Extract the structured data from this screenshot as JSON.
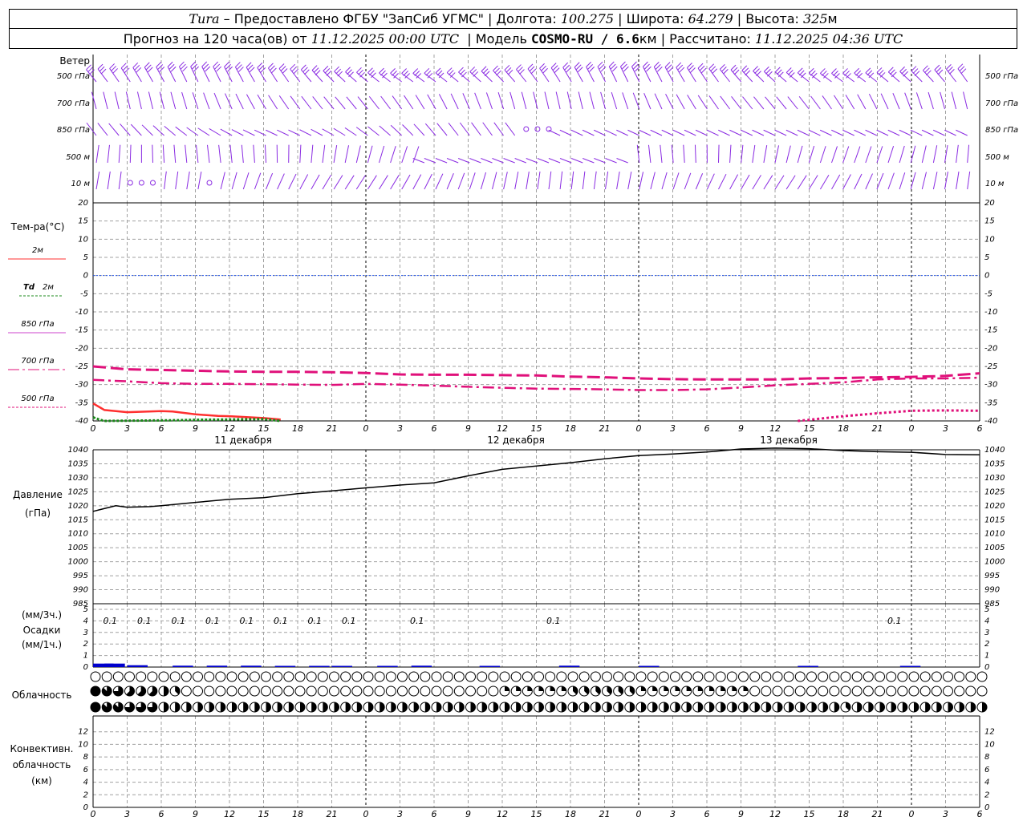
{
  "header": {
    "station": "Tura",
    "provider": "– Предоставлено ФГБУ \"ЗапСиб УГМС\"",
    "lon_label": "Долгота:",
    "lon": "100.275",
    "lat_label": "Широта:",
    "lat": "64.279",
    "alt_label": "Высота:",
    "alt": "325",
    "alt_unit": "м",
    "fc_label": "Прогноз на 120 часа(ов) от",
    "fc_start": "11.12.2025 00:00 UTC",
    "model_label": "Модель",
    "model": "COSMO-RU / 6.6",
    "model_unit": "км",
    "calc_label": "Рассчитано:",
    "calc_time": "11.12.2025 04:36 UTC"
  },
  "labels": {
    "wind": "Ветер",
    "wind_levels": [
      "500 гПа",
      "700 гПа",
      "850 гПа",
      "500 м",
      "10 м"
    ],
    "temp_title": "Тем-ра(°С)",
    "leg_2m": "2м",
    "leg_td": "Td",
    "leg_td2": "2м",
    "leg_850": "850 гПа",
    "leg_700": "700 гПа",
    "leg_500": "500 гПа",
    "pressure": "Давление",
    "pressure_unit": "(гПа)",
    "precip_unit3": "(мм/3ч.)",
    "precip": "Осадки",
    "precip_unit1": "(мм/1ч.)",
    "cloud": "Облачность",
    "conv1": "Конвективн.",
    "conv2": "облачность",
    "conv3": "(км)",
    "day1": "11 декабря",
    "day2": "12 декабря",
    "day3": "13 декабря"
  },
  "colors": {
    "t2m": "#ff3030",
    "td2m": "#1a8a1a",
    "t850": "#cc44cc",
    "t700": "#e0107a",
    "t500": "#e0107a",
    "pressure": "#000000",
    "precip": "#0000cc",
    "wind": "#8a2be2",
    "zero_line": "#2255ee"
  },
  "chart_data": [
    {
      "type": "line",
      "name": "temperature",
      "x_hours": [
        0,
        3,
        6,
        9,
        12,
        15,
        18,
        21,
        24,
        27,
        30,
        33,
        36,
        39,
        42,
        45,
        48,
        51,
        54,
        57,
        60,
        63,
        66,
        69,
        72,
        75,
        78
      ],
      "x_tick_labels": [
        "0",
        "3",
        "6",
        "9",
        "12",
        "15",
        "18",
        "21",
        "0",
        "3",
        "6",
        "9",
        "12",
        "15",
        "18",
        "21",
        "0",
        "3",
        "6",
        "9",
        "12",
        "15",
        "18",
        "21",
        "0",
        "3",
        "6"
      ],
      "ylim": [
        -40,
        20
      ],
      "y_ticks": [
        20,
        15,
        10,
        5,
        0,
        -5,
        -10,
        -15,
        -20,
        -25,
        -30,
        -35,
        -40
      ],
      "series": [
        {
          "name": "2м",
          "x": [
            0,
            1,
            3,
            6,
            7,
            9,
            11,
            12,
            15,
            16.5
          ],
          "y": [
            -35.2,
            -37,
            -37.6,
            -37.3,
            -37.4,
            -38.2,
            -38.6,
            -38.7,
            -39.2,
            -39.6
          ]
        },
        {
          "name": "Td 2м",
          "x": [
            0,
            0.6,
            1,
            7.5,
            9,
            12,
            15,
            16.5
          ],
          "y": [
            -39,
            -39.7,
            -40,
            -39.8,
            -39.7,
            -39.6,
            -39.5,
            -40
          ]
        },
        {
          "name": "700 гПа",
          "x": [
            0,
            3,
            6,
            9,
            12,
            15,
            18,
            21,
            24,
            27,
            30,
            33,
            36,
            39,
            42,
            45,
            48,
            51,
            54,
            57,
            60,
            63,
            66,
            69,
            72,
            75,
            78
          ],
          "y": [
            -25,
            -25.8,
            -26,
            -26.2,
            -26.4,
            -26.5,
            -26.5,
            -26.6,
            -26.8,
            -27.2,
            -27.3,
            -27.3,
            -27.4,
            -27.5,
            -27.8,
            -28,
            -28.3,
            -28.5,
            -28.6,
            -28.6,
            -28.6,
            -28.3,
            -28.2,
            -28,
            -27.9,
            -27.6,
            -26.9
          ]
        },
        {
          "name": "850 гПа",
          "x": [
            0,
            3,
            6,
            9,
            12,
            15,
            18,
            21,
            24,
            27,
            30,
            33,
            36,
            39,
            42,
            45,
            48,
            51,
            54,
            57,
            60,
            63,
            66,
            69,
            72,
            75,
            78
          ],
          "y": [
            -28.7,
            -29.1,
            -29.6,
            -29.8,
            -29.8,
            -29.9,
            -30,
            -30.1,
            -29.8,
            -30,
            -30.3,
            -30.6,
            -30.9,
            -31.1,
            -31.2,
            -31.3,
            -31.5,
            -31.5,
            -31.3,
            -30.8,
            -30.2,
            -29.8,
            -29.4,
            -28.6,
            -28.3,
            -28.3,
            -28.1
          ]
        },
        {
          "name": "500 гПа",
          "x": [
            62,
            63,
            66,
            69,
            72,
            75,
            78
          ],
          "y": [
            -40,
            -39.7,
            -38.7,
            -37.9,
            -37.2,
            -37.1,
            -37.2
          ]
        }
      ]
    },
    {
      "type": "line",
      "name": "pressure",
      "ylim": [
        985,
        1040
      ],
      "y_ticks": [
        1040,
        1035,
        1030,
        1025,
        1020,
        1015,
        1010,
        1005,
        1000,
        995,
        990,
        985
      ],
      "series": [
        {
          "name": "Давление",
          "x": [
            0,
            2,
            3,
            5,
            6,
            9,
            12,
            15,
            18,
            21,
            24,
            27,
            30,
            33,
            36,
            39,
            42,
            45,
            48,
            51,
            54,
            57,
            60,
            63,
            66,
            69,
            72,
            75,
            78
          ],
          "y": [
            1018,
            1020,
            1019.5,
            1019.7,
            1020,
            1021.2,
            1022.3,
            1022.9,
            1024.3,
            1025.3,
            1026.4,
            1027.4,
            1028.2,
            1030.7,
            1033,
            1034.2,
            1035.4,
            1036.8,
            1037.9,
            1038.5,
            1039.2,
            1040.3,
            1040.6,
            1040.4,
            1039.7,
            1039.3,
            1039.1,
            1038.3,
            1038.2
          ]
        }
      ]
    },
    {
      "type": "bar",
      "name": "precipitation",
      "ylim": [
        0,
        5
      ],
      "y_ticks": [
        5,
        4,
        3,
        2,
        1,
        0
      ],
      "labels_3h": [
        {
          "x": 1.5,
          "text": "0.1"
        },
        {
          "x": 4.5,
          "text": "0.1"
        },
        {
          "x": 7.5,
          "text": "0.1"
        },
        {
          "x": 10.5,
          "text": "0.1"
        },
        {
          "x": 13.5,
          "text": "0.1"
        },
        {
          "x": 16.5,
          "text": "0.1"
        },
        {
          "x": 19.5,
          "text": "0.1"
        },
        {
          "x": 22.5,
          "text": "0.1"
        },
        {
          "x": 28.5,
          "text": "0.1"
        },
        {
          "x": 40.5,
          "text": "0.1"
        },
        {
          "x": 70.5,
          "text": "0.1"
        }
      ],
      "bars_x": [
        0,
        1,
        3,
        7,
        10,
        13,
        16,
        19,
        21,
        25,
        28,
        34,
        41,
        48,
        62,
        71
      ],
      "values": [
        0.15,
        0.15,
        0.08,
        0.06,
        0.06,
        0.06,
        0.05,
        0.05,
        0.05,
        0.05,
        0.06,
        0.05,
        0.06,
        0.05,
        0.05,
        0.05
      ]
    },
    {
      "type": "table",
      "name": "cloud_cover",
      "columns": 79,
      "rows": [
        {
          "level": "high",
          "fill": "0000000000000000000000000000000000000000000000000000000000000000000000000000000"
        },
        {
          "level": "mid",
          "fill": "8765554300000000000000000000000000002222223333332222222222000000000000000000000"
        },
        {
          "level": "low",
          "fill": "8776664444444444444444444444444444444444444444444444444444444444443444444444444"
        }
      ]
    },
    {
      "type": "line",
      "name": "convective_cloud",
      "ylim": [
        0,
        14
      ],
      "y_ticks": [
        12,
        10,
        8,
        6,
        4,
        2,
        0
      ],
      "series": [
        {
          "name": "Конвективн. облачность",
          "x": [],
          "y": []
        }
      ]
    }
  ]
}
